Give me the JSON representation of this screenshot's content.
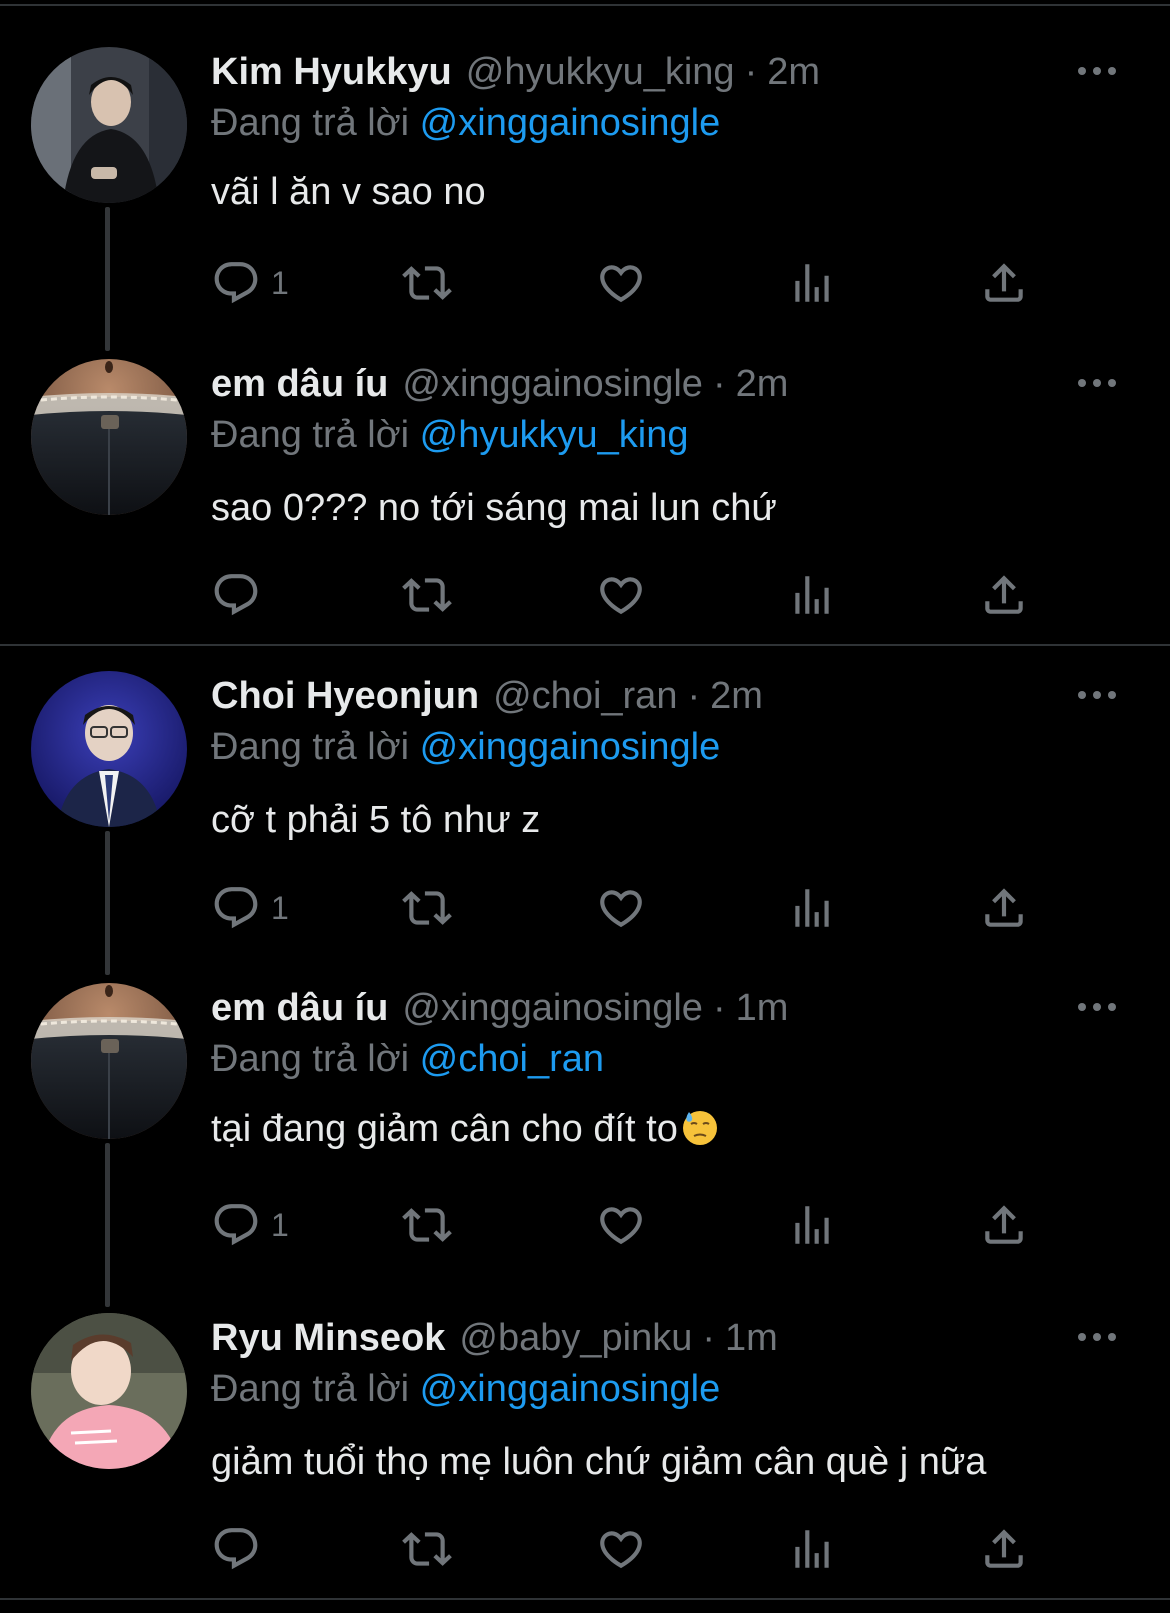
{
  "reply_prefix": "Đang trả lời",
  "colors": {
    "background": "#000000",
    "text": "#e7e9ea",
    "muted": "#71767b",
    "link": "#1d9bf0",
    "divider": "#2f3336"
  },
  "icons": [
    "reply-icon",
    "retweet-icon",
    "like-icon",
    "views-icon",
    "share-icon",
    "more-icon"
  ],
  "tweets": [
    {
      "name": "Kim Hyukkyu",
      "handle": "@hyukkyu_king",
      "dot": "·",
      "time": "2m",
      "reply_to": "@xinggainosingle",
      "text": "vãi l ăn v sao no",
      "reply_count": "1"
    },
    {
      "name": "em dâu íu",
      "handle": "@xinggainosingle",
      "dot": "·",
      "time": "2m",
      "reply_to": "@hyukkyu_king",
      "text": "sao 0??? no tới sáng mai lun chứ",
      "reply_count": ""
    },
    {
      "name": "Choi Hyeonjun",
      "handle": "@choi_ran",
      "dot": "·",
      "time": "2m",
      "reply_to": "@xinggainosingle",
      "text": "cỡ t phải 5 tô như z",
      "reply_count": "1"
    },
    {
      "name": "em dâu íu",
      "handle": "@xinggainosingle",
      "dot": "·",
      "time": "1m",
      "reply_to": "@choi_ran",
      "text": "tại đang giảm cân cho đít to",
      "emoji": "downcast-face-with-sweat",
      "reply_count": "1"
    },
    {
      "name": "Ryu Minseok",
      "handle": "@baby_pinku",
      "dot": "·",
      "time": "1m",
      "reply_to": "@xinggainosingle",
      "text": "giảm tuổi thọ mẹ luôn chứ giảm cân què j nữa",
      "reply_count": ""
    }
  ]
}
